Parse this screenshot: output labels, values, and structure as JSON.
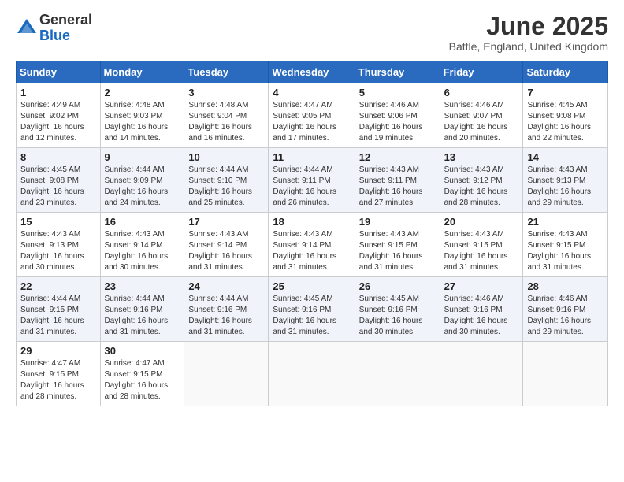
{
  "logo": {
    "general": "General",
    "blue": "Blue"
  },
  "title": "June 2025",
  "subtitle": "Battle, England, United Kingdom",
  "days_header": [
    "Sunday",
    "Monday",
    "Tuesday",
    "Wednesday",
    "Thursday",
    "Friday",
    "Saturday"
  ],
  "weeks": [
    [
      {
        "day": "1",
        "sunrise": "4:49 AM",
        "sunset": "9:02 PM",
        "daylight": "16 hours and 12 minutes."
      },
      {
        "day": "2",
        "sunrise": "4:48 AM",
        "sunset": "9:03 PM",
        "daylight": "16 hours and 14 minutes."
      },
      {
        "day": "3",
        "sunrise": "4:48 AM",
        "sunset": "9:04 PM",
        "daylight": "16 hours and 16 minutes."
      },
      {
        "day": "4",
        "sunrise": "4:47 AM",
        "sunset": "9:05 PM",
        "daylight": "16 hours and 17 minutes."
      },
      {
        "day": "5",
        "sunrise": "4:46 AM",
        "sunset": "9:06 PM",
        "daylight": "16 hours and 19 minutes."
      },
      {
        "day": "6",
        "sunrise": "4:46 AM",
        "sunset": "9:07 PM",
        "daylight": "16 hours and 20 minutes."
      },
      {
        "day": "7",
        "sunrise": "4:45 AM",
        "sunset": "9:08 PM",
        "daylight": "16 hours and 22 minutes."
      }
    ],
    [
      {
        "day": "8",
        "sunrise": "4:45 AM",
        "sunset": "9:08 PM",
        "daylight": "16 hours and 23 minutes."
      },
      {
        "day": "9",
        "sunrise": "4:44 AM",
        "sunset": "9:09 PM",
        "daylight": "16 hours and 24 minutes."
      },
      {
        "day": "10",
        "sunrise": "4:44 AM",
        "sunset": "9:10 PM",
        "daylight": "16 hours and 25 minutes."
      },
      {
        "day": "11",
        "sunrise": "4:44 AM",
        "sunset": "9:11 PM",
        "daylight": "16 hours and 26 minutes."
      },
      {
        "day": "12",
        "sunrise": "4:43 AM",
        "sunset": "9:11 PM",
        "daylight": "16 hours and 27 minutes."
      },
      {
        "day": "13",
        "sunrise": "4:43 AM",
        "sunset": "9:12 PM",
        "daylight": "16 hours and 28 minutes."
      },
      {
        "day": "14",
        "sunrise": "4:43 AM",
        "sunset": "9:13 PM",
        "daylight": "16 hours and 29 minutes."
      }
    ],
    [
      {
        "day": "15",
        "sunrise": "4:43 AM",
        "sunset": "9:13 PM",
        "daylight": "16 hours and 30 minutes."
      },
      {
        "day": "16",
        "sunrise": "4:43 AM",
        "sunset": "9:14 PM",
        "daylight": "16 hours and 30 minutes."
      },
      {
        "day": "17",
        "sunrise": "4:43 AM",
        "sunset": "9:14 PM",
        "daylight": "16 hours and 31 minutes."
      },
      {
        "day": "18",
        "sunrise": "4:43 AM",
        "sunset": "9:14 PM",
        "daylight": "16 hours and 31 minutes."
      },
      {
        "day": "19",
        "sunrise": "4:43 AM",
        "sunset": "9:15 PM",
        "daylight": "16 hours and 31 minutes."
      },
      {
        "day": "20",
        "sunrise": "4:43 AM",
        "sunset": "9:15 PM",
        "daylight": "16 hours and 31 minutes."
      },
      {
        "day": "21",
        "sunrise": "4:43 AM",
        "sunset": "9:15 PM",
        "daylight": "16 hours and 31 minutes."
      }
    ],
    [
      {
        "day": "22",
        "sunrise": "4:44 AM",
        "sunset": "9:15 PM",
        "daylight": "16 hours and 31 minutes."
      },
      {
        "day": "23",
        "sunrise": "4:44 AM",
        "sunset": "9:16 PM",
        "daylight": "16 hours and 31 minutes."
      },
      {
        "day": "24",
        "sunrise": "4:44 AM",
        "sunset": "9:16 PM",
        "daylight": "16 hours and 31 minutes."
      },
      {
        "day": "25",
        "sunrise": "4:45 AM",
        "sunset": "9:16 PM",
        "daylight": "16 hours and 31 minutes."
      },
      {
        "day": "26",
        "sunrise": "4:45 AM",
        "sunset": "9:16 PM",
        "daylight": "16 hours and 30 minutes."
      },
      {
        "day": "27",
        "sunrise": "4:46 AM",
        "sunset": "9:16 PM",
        "daylight": "16 hours and 30 minutes."
      },
      {
        "day": "28",
        "sunrise": "4:46 AM",
        "sunset": "9:16 PM",
        "daylight": "16 hours and 29 minutes."
      }
    ],
    [
      {
        "day": "29",
        "sunrise": "4:47 AM",
        "sunset": "9:15 PM",
        "daylight": "16 hours and 28 minutes."
      },
      {
        "day": "30",
        "sunrise": "4:47 AM",
        "sunset": "9:15 PM",
        "daylight": "16 hours and 28 minutes."
      },
      null,
      null,
      null,
      null,
      null
    ]
  ]
}
